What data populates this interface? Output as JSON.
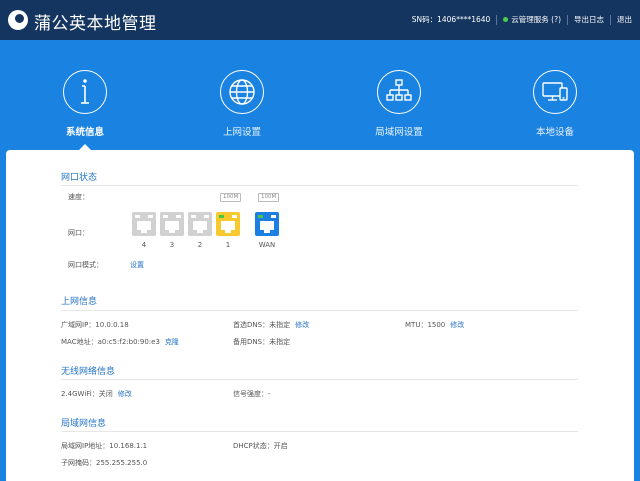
{
  "header": {
    "title": "蒲公英本地管理",
    "sn": "SN码：1406****1640",
    "cloud_service": "云管理服务 (?)",
    "export_log": "导出日志",
    "logout": "退出"
  },
  "nav": {
    "items": [
      {
        "label": "系统信息",
        "icon": "info-icon",
        "active": true
      },
      {
        "label": "上网设置",
        "icon": "globe-icon",
        "active": false
      },
      {
        "label": "局域网设置",
        "icon": "network-icon",
        "active": false
      },
      {
        "label": "本地设备",
        "icon": "devices-icon",
        "active": false
      }
    ]
  },
  "port_status": {
    "title": "网口状态",
    "speed_label": "速度：",
    "port_label": "网口：",
    "mode_label": "网口模式：",
    "mode_link": "设置",
    "speed_badges": [
      "100M",
      "100M"
    ],
    "ports": [
      {
        "name": "4",
        "state": "idle"
      },
      {
        "name": "3",
        "state": "idle"
      },
      {
        "name": "2",
        "state": "idle"
      },
      {
        "name": "1",
        "state": "active"
      },
      {
        "name": "WAN",
        "state": "wan"
      }
    ]
  },
  "internet": {
    "title": "上网信息",
    "wan_ip": "广域网IP：10.0.0.18",
    "mac": "MAC地址：a0:c5:f2:b0:90:e3",
    "mac_link": "克隆",
    "dns1": "首选DNS：未指定",
    "dns1_link": "修改",
    "dns2": "备用DNS：未指定",
    "mtu": "MTU：1500",
    "mtu_link": "修改"
  },
  "wireless": {
    "title": "无线网络信息",
    "wifi": "2.4GWiFi：关闭",
    "wifi_link": "修改",
    "signal": "信号强度：-"
  },
  "lan": {
    "title": "局域网信息",
    "ip": "局域网IP地址：10.168.1.1",
    "dhcp": "DHCP状态：开启",
    "mask": "子网掩码：255.255.255.0"
  },
  "colors": {
    "header_bg": "#13355f",
    "body_bg": "#1a82e0",
    "accent": "#2373c8",
    "port_active": "#f8c92d",
    "port_wan": "#1a7fe0",
    "status_ok": "#4ccd4c"
  }
}
